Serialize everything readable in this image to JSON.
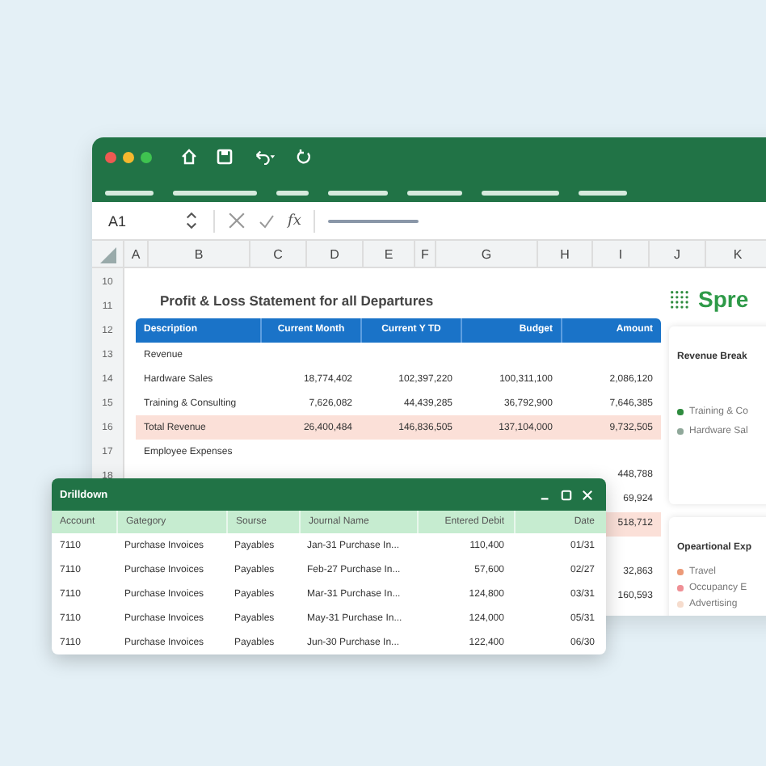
{
  "formula_bar": {
    "cell_ref": "A1",
    "fx": "fx"
  },
  "columns": [
    "A",
    "B",
    "C",
    "D",
    "E",
    "F",
    "G",
    "H",
    "I",
    "J",
    "K"
  ],
  "row_numbers": [
    "10",
    "11",
    "12",
    "13",
    "14",
    "15",
    "16",
    "17",
    "18"
  ],
  "report": {
    "title": "Profit & Loss Statement for all Departures",
    "columns": [
      "Description",
      "Current Month",
      "Current Y TD",
      "Budget",
      "Amount"
    ],
    "rows": [
      {
        "kind": "section",
        "cells": [
          "Revenue"
        ]
      },
      {
        "kind": "item",
        "cells": [
          "Hardware Sales",
          "18,774,402",
          "102,397,220",
          "100,311,100",
          "2,086,120"
        ]
      },
      {
        "kind": "item",
        "cells": [
          "Training & Consulting",
          "7,626,082",
          "44,439,285",
          "36,792,900",
          "7,646,385"
        ]
      },
      {
        "kind": "total",
        "cells": [
          "Total Revenue",
          "26,400,484",
          "146,836,505",
          "137,104,000",
          "9,732,505"
        ]
      },
      {
        "kind": "section",
        "cells": [
          "Employee Expenses"
        ]
      },
      {
        "kind": "partial",
        "amount": "448,788"
      },
      {
        "kind": "partial",
        "amount": "69,924"
      },
      {
        "kind": "partial_total",
        "amount": "518,712"
      },
      {
        "kind": "blank"
      },
      {
        "kind": "partial",
        "amount": "32,863"
      },
      {
        "kind": "partial",
        "amount": "160,593"
      }
    ]
  },
  "side_panel": {
    "logo": "Spre",
    "cards": [
      {
        "title": "Revenue Break",
        "legend": [
          {
            "label": "Training & Co",
            "color": "#2e8b3e"
          },
          {
            "label": "Hardware Sal",
            "color": "#8fa89a"
          }
        ]
      },
      {
        "title": "Opeartional Exp",
        "legend": [
          {
            "label": "Travel",
            "color": "#ec9a78"
          },
          {
            "label": "Occupancy E",
            "color": "#ef8f95"
          },
          {
            "label": "Advertising",
            "color": "#f6dccd"
          }
        ]
      }
    ]
  },
  "drilldown": {
    "title": "Drilldown",
    "columns": [
      "Account",
      "Gategory",
      "Sourse",
      "Journal Name",
      "Entered Debit",
      "Date"
    ],
    "rows": [
      [
        "7110",
        "Purchase Invoices",
        "Payables",
        "Jan-31 Purchase In...",
        "110,400",
        "01/31"
      ],
      [
        "7110",
        "Purchase Invoices",
        "Payables",
        "Feb-27 Purchase In...",
        "57,600",
        "02/27"
      ],
      [
        "7110",
        "Purchase Invoices",
        "Payables",
        "Mar-31 Purchase In...",
        "124,800",
        "03/31"
      ],
      [
        "7110",
        "Purchase Invoices",
        "Payables",
        "May-31 Purchase In...",
        "124,000",
        "05/31"
      ],
      [
        "7110",
        "Purchase Invoices",
        "Payables",
        "Jun-30 Purchase In...",
        "122,400",
        "06/30"
      ]
    ]
  }
}
